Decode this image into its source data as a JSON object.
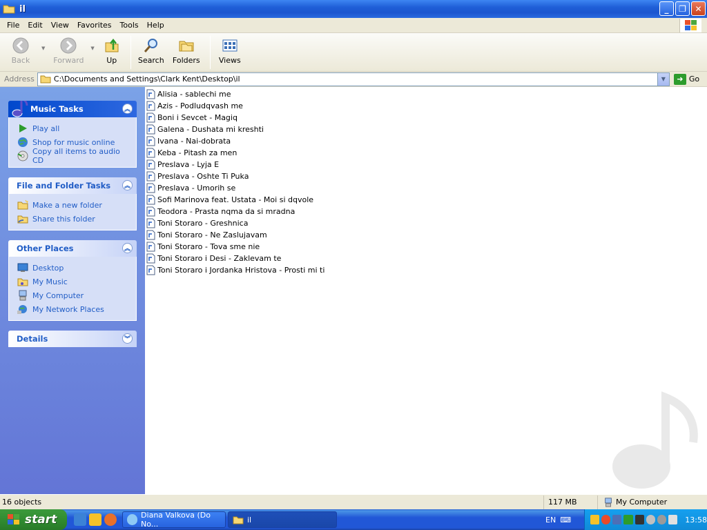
{
  "window": {
    "title": "il"
  },
  "menu": [
    "File",
    "Edit",
    "View",
    "Favorites",
    "Tools",
    "Help"
  ],
  "toolbar": {
    "back": "Back",
    "forward": "Forward",
    "up": "Up",
    "search": "Search",
    "folders": "Folders",
    "views": "Views"
  },
  "address": {
    "label": "Address",
    "value": "C:\\Documents and Settings\\Clark Kent\\Desktop\\il",
    "go": "Go"
  },
  "tasks": {
    "music": {
      "title": "Music Tasks",
      "items": [
        "Play all",
        "Shop for music online",
        "Copy all items to audio CD"
      ]
    },
    "file_folder": {
      "title": "File and Folder Tasks",
      "items": [
        "Make a new folder",
        "Share this folder"
      ]
    },
    "other_places": {
      "title": "Other Places",
      "items": [
        "Desktop",
        "My Music",
        "My Computer",
        "My Network Places"
      ]
    },
    "details": {
      "title": "Details"
    }
  },
  "files": [
    "Alisia - sablechi me",
    "Azis - Podludqvash me",
    "Boni i Sevcet - Magiq",
    "Galena - Dushata mi kreshti",
    "Ivana - Nai-dobrata",
    "Keba - Pitash za men",
    "Preslava - Lyja E",
    "Preslava - Oshte Ti Puka",
    "Preslava - Umorih se",
    "Sofi Marinova feat. Ustata - Moi si dqvole",
    "Teodora - Prasta nqma da si mradna",
    "Toni Storaro - Greshnica",
    "Toni Storaro - Ne Zaslujavam",
    "Toni Storaro - Tova sme nie",
    "Toni Storaro i Desi - Zaklevam te",
    "Toni Storaro i Jordanka Hristova - Prosti mi ti"
  ],
  "status": {
    "objects": "16 objects",
    "size": "117 MB",
    "location": "My Computer"
  },
  "taskbar": {
    "start": "start",
    "tasks": [
      "Diana Valkova (Do No...",
      "il"
    ],
    "lang": "EN",
    "clock": "13:58"
  },
  "colors": {
    "title_blue": "#1f5fd7",
    "task_pane_blue": "#6375d6",
    "link_blue": "#215dc6",
    "start_green": "#2f892f"
  }
}
